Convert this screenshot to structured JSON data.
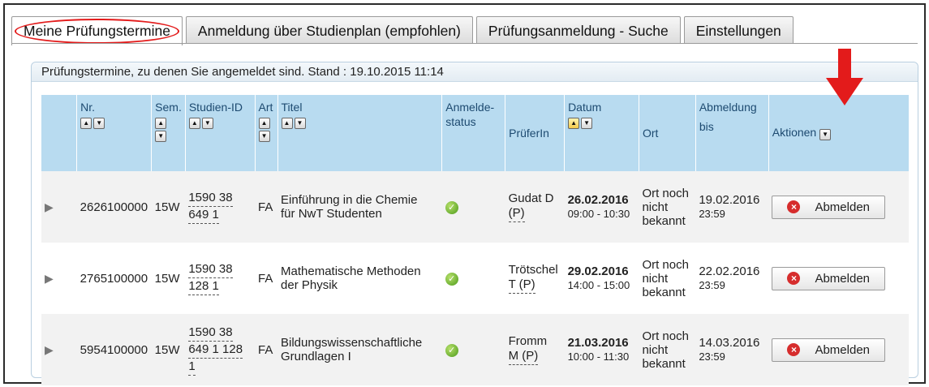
{
  "tabs": [
    {
      "label": "Meine Prüfungstermine",
      "active": true
    },
    {
      "label": "Anmeldung über Studienplan (empfohlen)",
      "active": false
    },
    {
      "label": "Prüfungsanmeldung - Suche",
      "active": false
    },
    {
      "label": "Einstellungen",
      "active": false
    }
  ],
  "panel": {
    "title": "Prüfungstermine, zu denen Sie angemeldet sind. Stand : 19.10.2015 11:14"
  },
  "columns": {
    "nr": "Nr.",
    "sem": "Sem.",
    "studien_id": "Studien-ID",
    "art": "Art",
    "titel": "Titel",
    "anmeldestatus_1": "Anmelde-",
    "anmeldestatus_2": "status",
    "pruefer": "PrüferIn",
    "datum": "Datum",
    "ort": "Ort",
    "abmeldung_1": "Abmeldung",
    "abmeldung_2": "bis",
    "aktionen": "Aktionen"
  },
  "rows": [
    {
      "nr": "2626100000",
      "sem": "15W",
      "studien_id_1": "1590 38",
      "studien_id_2": "649 1",
      "studien_id_3": "",
      "art": "FA",
      "titel_1": "Einführung in die Chemie",
      "titel_2": "für NwT Studenten",
      "pruefer_1": "Gudat D",
      "pruefer_2": "(P)",
      "datum": "26.02.2016",
      "zeit": "09:00 - 10:30",
      "ort_1": "Ort noch",
      "ort_2": "nicht",
      "ort_3": "bekannt",
      "abmeldung_datum": "19.02.2016",
      "abmeldung_zeit": "23:59",
      "action": "Abmelden"
    },
    {
      "nr": "2765100000",
      "sem": "15W",
      "studien_id_1": "1590 38",
      "studien_id_2": "128 1",
      "studien_id_3": "",
      "art": "FA",
      "titel_1": "Mathematische Methoden",
      "titel_2": "der Physik",
      "pruefer_1": "Trötschel",
      "pruefer_2": "T (P)",
      "datum": "29.02.2016",
      "zeit": "14:00 - 15:00",
      "ort_1": "Ort noch",
      "ort_2": "nicht",
      "ort_3": "bekannt",
      "abmeldung_datum": "22.02.2016",
      "abmeldung_zeit": "23:59",
      "action": "Abmelden"
    },
    {
      "nr": "5954100000",
      "sem": "15W",
      "studien_id_1": "1590 38",
      "studien_id_2": "649 1 128",
      "studien_id_3": "1",
      "art": "FA",
      "titel_1": "Bildungswissenschaftliche",
      "titel_2": "Grundlagen I",
      "pruefer_1": "Fromm",
      "pruefer_2": "M (P)",
      "datum": "21.03.2016",
      "zeit": "10:00 - 11:30",
      "ort_1": "Ort noch",
      "ort_2": "nicht",
      "ort_3": "bekannt",
      "abmeldung_datum": "14.03.2016",
      "abmeldung_zeit": "23:59",
      "action": "Abmelden"
    }
  ],
  "colors": {
    "header_bg": "#b8dbf0",
    "header_text": "#1d4a70",
    "annotation_red": "#e31b1b",
    "status_ok": "#4c9a1b",
    "abmelden_icon": "#d62d2d"
  },
  "icons": {
    "row_expander": "triangle-right-icon",
    "sort_up": "sort-ascending-icon",
    "sort_filter": "filter-icon",
    "status": "checkmark-icon",
    "abmelden": "x-circle-icon",
    "annotation": "down-arrow-icon"
  }
}
